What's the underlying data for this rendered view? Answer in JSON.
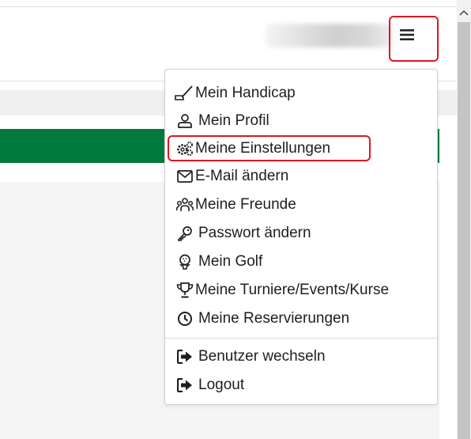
{
  "header": {
    "menu_icon": "hamburger-icon",
    "scroll_up_icon": "chevron-up-icon"
  },
  "colors": {
    "accent_green": "#007a3d",
    "highlight_red": "#e1151f"
  },
  "user_menu": {
    "items": [
      {
        "label": "Mein Handicap",
        "icon": "handicap-icon"
      },
      {
        "label": "Mein Profil",
        "icon": "user-icon"
      },
      {
        "label": "Meine Einstellungen",
        "icon": "gears-icon"
      },
      {
        "label": "E-Mail ändern",
        "icon": "envelope-icon"
      },
      {
        "label": "Meine Freunde",
        "icon": "friends-icon"
      },
      {
        "label": "Passwort ändern",
        "icon": "key-icon"
      },
      {
        "label": "Mein Golf",
        "icon": "golf-tee-icon"
      },
      {
        "label": "Meine Turniere/Events/Kurse",
        "icon": "trophy-icon"
      },
      {
        "label": "Meine Reservierungen",
        "icon": "clock-icon"
      }
    ],
    "secondary_items": [
      {
        "label": "Benutzer wechseln",
        "icon": "switch-user-icon"
      },
      {
        "label": "Logout",
        "icon": "logout-icon"
      }
    ]
  }
}
